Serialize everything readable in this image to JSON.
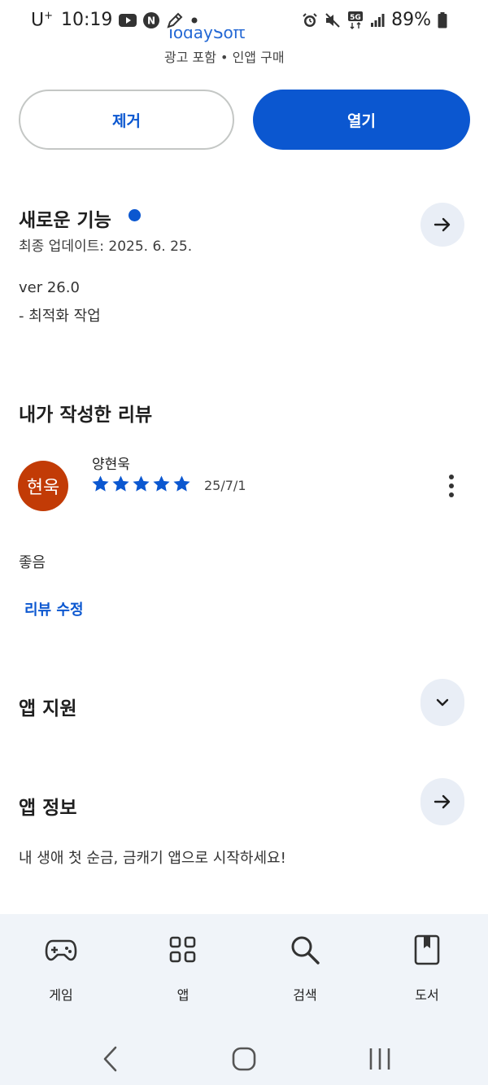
{
  "status_bar": {
    "carrier": "U",
    "carrier_sup": "+",
    "time": "10:19",
    "network": "5G",
    "battery": "89%"
  },
  "app": {
    "developer": "TodaySoft",
    "meta": "광고 포함 • 인앱 구매"
  },
  "buttons": {
    "remove": "제거",
    "open": "열기"
  },
  "whats_new": {
    "title": "새로운 기능",
    "updated": "최종 업데이트: 2025. 6. 25.",
    "version": "ver 26.0",
    "notes": "- 최적화 작업"
  },
  "my_review": {
    "title": "내가 작성한 리뷰",
    "avatar_text": "현욱",
    "reviewer": "양현욱",
    "rating": 5,
    "date": "25/7/1",
    "text": "좋음",
    "edit_label": "리뷰 수정"
  },
  "app_support": {
    "title": "앱 지원"
  },
  "app_info": {
    "title": "앱 정보",
    "description": "내 생애 첫 순금, 금캐기 앱으로 시작하세요!"
  },
  "bottom_nav": {
    "items": [
      {
        "label": "게임",
        "icon": "gamepad-icon"
      },
      {
        "label": "앱",
        "icon": "apps-grid-icon"
      },
      {
        "label": "검색",
        "icon": "search-icon"
      },
      {
        "label": "도서",
        "icon": "book-icon"
      }
    ]
  },
  "colors": {
    "accent": "#0b57d0",
    "avatar": "#c23b06",
    "round_button_bg": "#e9eef6",
    "nav_bg": "#f0f4f9"
  }
}
